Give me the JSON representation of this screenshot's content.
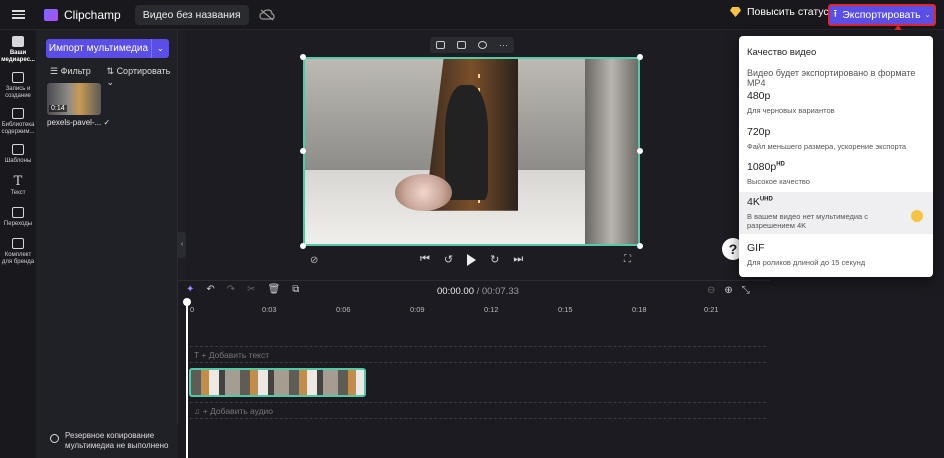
{
  "app": {
    "name": "Clipchamp",
    "project_title": "Видео без названия"
  },
  "header": {
    "upgrade_label": "Повысить статус",
    "export_label": "Экспортировать"
  },
  "nav": [
    {
      "label": "Ваши медиарес..."
    },
    {
      "label": "Запись и создание"
    },
    {
      "label": "Библиотека содержим..."
    },
    {
      "label": "Шаблоны"
    },
    {
      "label": "Текст"
    },
    {
      "label": "Переходы"
    },
    {
      "label": "Комплект для бренда"
    }
  ],
  "media": {
    "import_label": "Импорт мультимедиа",
    "filter_label": "Фильтр",
    "sort_label": "Сортировать",
    "item": {
      "name": "pexels-pavel-...",
      "duration": "0:14"
    }
  },
  "backup": {
    "text": "Резервное копирование мультимедиа не выполнено"
  },
  "timeline": {
    "current": "00:00.00",
    "total": "/ 00:07.33",
    "ruler": [
      "0",
      "0:03",
      "0:06",
      "0:09",
      "0:12",
      "0:15",
      "0:18",
      "0:21"
    ],
    "text_track": "+ Добавить текст",
    "audio_track": "+ Добавить аудио"
  },
  "export_menu": {
    "heading": "Качество видео",
    "subtitle": "Видео будет экспортировано в формате MP4",
    "options": [
      {
        "title": "480p",
        "sup": "",
        "desc": "Для черновых вариантов"
      },
      {
        "title": "720p",
        "sup": "",
        "desc": "Файл меньшего размера, ускорение экспорта"
      },
      {
        "title": "1080p",
        "sup": "HD",
        "desc": "Высокое качество"
      },
      {
        "title": "4K",
        "sup": "UHD",
        "desc": "В вашем видео нет мультимедиа с разрешением 4K"
      },
      {
        "title": "GIF",
        "sup": "",
        "desc": "Для роликов длиной до 15 секунд"
      }
    ]
  },
  "help_label": "?"
}
